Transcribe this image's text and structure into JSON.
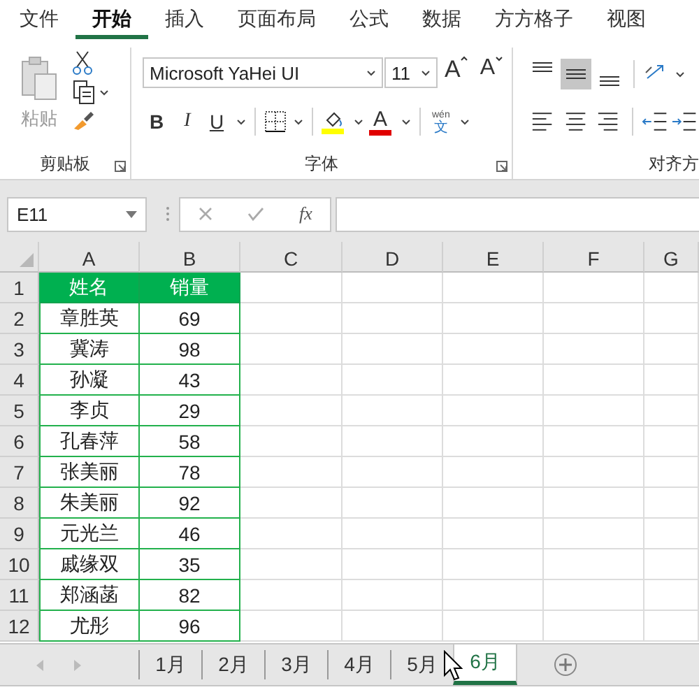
{
  "menu_tabs": [
    {
      "label": "文件",
      "selected": false
    },
    {
      "label": "开始",
      "selected": true
    },
    {
      "label": "插入",
      "selected": false
    },
    {
      "label": "页面布局",
      "selected": false
    },
    {
      "label": "公式",
      "selected": false
    },
    {
      "label": "数据",
      "selected": false
    },
    {
      "label": "方方格子",
      "selected": false
    },
    {
      "label": "视图",
      "selected": false
    }
  ],
  "ribbon": {
    "clipboard": {
      "paste_label": "粘贴",
      "group_label": "剪贴板"
    },
    "font": {
      "font_name": "Microsoft YaHei UI",
      "font_size": "11",
      "grow_label": "A",
      "shrink_label": "A",
      "bold_label": "B",
      "italic_label": "I",
      "underline_label": "U",
      "font_color_label": "A",
      "phonetic_label": "wén",
      "phonetic_char": "文",
      "group_label": "字体"
    },
    "alignment": {
      "vertical": [
        {
          "selected": false
        },
        {
          "selected": true
        },
        {
          "selected": false
        }
      ],
      "group_label": "对齐方"
    }
  },
  "formula_bar": {
    "name_box": "E11",
    "function_label": "fx"
  },
  "sheet": {
    "columns": [
      "A",
      "B",
      "C",
      "D",
      "E",
      "F",
      "G"
    ],
    "rows": [
      {
        "number": "1",
        "kind": "header",
        "cells": [
          "姓名",
          "销量"
        ]
      },
      {
        "number": "2",
        "kind": "data",
        "cells": [
          "章胜英",
          "69"
        ]
      },
      {
        "number": "3",
        "kind": "data",
        "cells": [
          "冀涛",
          "98"
        ]
      },
      {
        "number": "4",
        "kind": "data",
        "cells": [
          "孙凝",
          "43"
        ]
      },
      {
        "number": "5",
        "kind": "data",
        "cells": [
          "李贞",
          "29"
        ]
      },
      {
        "number": "6",
        "kind": "data",
        "cells": [
          "孔春萍",
          "58"
        ]
      },
      {
        "number": "7",
        "kind": "data",
        "cells": [
          "张美丽",
          "78"
        ]
      },
      {
        "number": "8",
        "kind": "data",
        "cells": [
          "朱美丽",
          "92"
        ]
      },
      {
        "number": "9",
        "kind": "data",
        "cells": [
          "元光兰",
          "46"
        ]
      },
      {
        "number": "10",
        "kind": "data",
        "cells": [
          "戚缘双",
          "35"
        ]
      },
      {
        "number": "11",
        "kind": "data",
        "cells": [
          "郑涵菡",
          "82"
        ]
      },
      {
        "number": "12",
        "kind": "data",
        "cells": [
          "尤彤",
          "96"
        ]
      }
    ]
  },
  "sheet_tabs": [
    {
      "label": "1月",
      "selected": false
    },
    {
      "label": "2月",
      "selected": false
    },
    {
      "label": "3月",
      "selected": false
    },
    {
      "label": "4月",
      "selected": false
    },
    {
      "label": "5月",
      "selected": false
    },
    {
      "label": "6月",
      "selected": true
    }
  ]
}
